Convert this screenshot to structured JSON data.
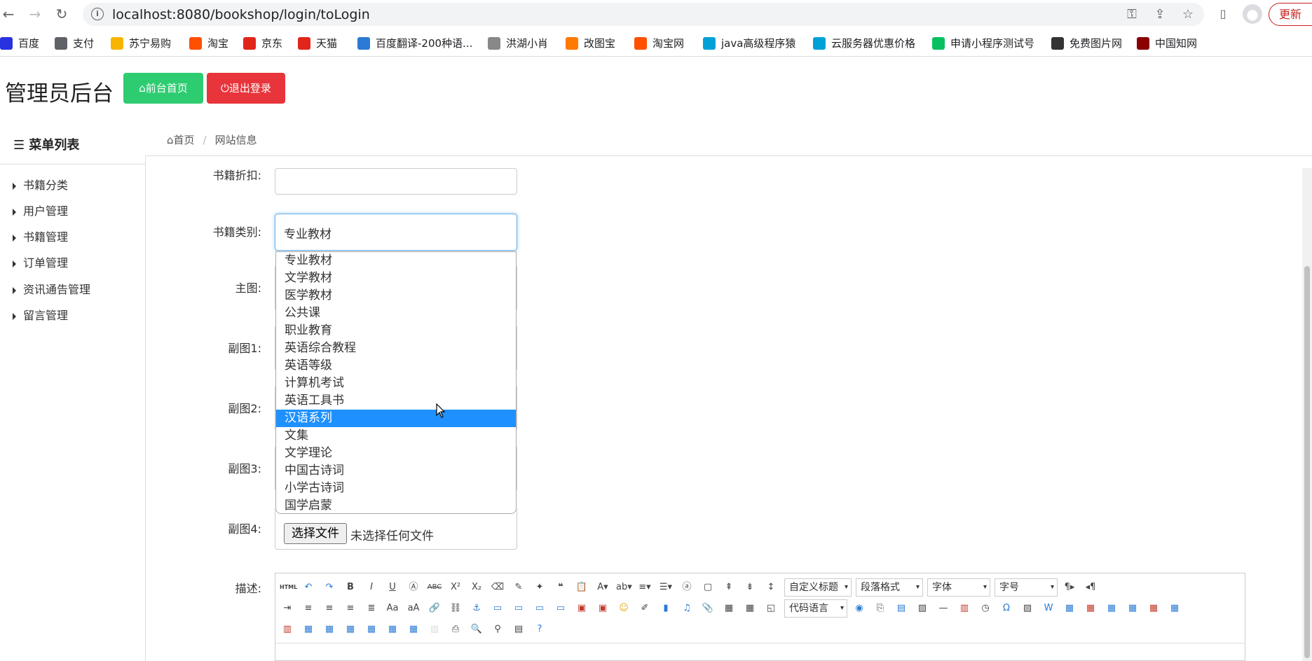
{
  "browser": {
    "url": "localhost:8080/bookshop/login/toLogin",
    "update_label": "更新",
    "bookmarks": [
      {
        "label": "百度",
        "color": "#2932e1",
        "icon": "paw-icon"
      },
      {
        "label": "支付",
        "color": "#5f6368",
        "icon": "globe-icon"
      },
      {
        "label": "苏宁易购",
        "color": "#f7b500",
        "icon": "lion-icon"
      },
      {
        "label": "淘宝",
        "color": "#ff5000",
        "icon": "tao-icon"
      },
      {
        "label": "京东",
        "color": "#e1251b",
        "icon": "jd-icon"
      },
      {
        "label": "天猫",
        "color": "#e1251b",
        "icon": "tmall-icon"
      },
      {
        "label": "百度翻译-200种语...",
        "color": "#2b7bd4",
        "icon": "translate-icon"
      },
      {
        "label": "洪湖小肖",
        "color": "#888888",
        "icon": "feather-icon"
      },
      {
        "label": "改图宝",
        "color": "#ff7a00",
        "icon": "image-icon"
      },
      {
        "label": "淘宝网",
        "color": "#ff5000",
        "icon": "tao-icon"
      },
      {
        "label": "java高级程序猿",
        "color": "#00a1d6",
        "icon": "bilibili-icon"
      },
      {
        "label": "云服务器优惠价格",
        "color": "#00a1d6",
        "icon": "cloud-icon"
      },
      {
        "label": "申请小程序测试号",
        "color": "#07c160",
        "icon": "wechat-icon"
      },
      {
        "label": "免费图片网",
        "color": "#333333",
        "icon": "t-icon"
      },
      {
        "label": "中国知网",
        "color": "#8b0000",
        "icon": "cnki-icon"
      }
    ]
  },
  "header": {
    "title": "管理员后台",
    "home_label": "前台首页",
    "logout_label": "退出登录"
  },
  "sidebar": {
    "title": "菜单列表",
    "items": [
      "书籍分类",
      "用户管理",
      "书籍管理",
      "订单管理",
      "资讯通告管理",
      "留言管理"
    ]
  },
  "breadcrumb": {
    "home": "首页",
    "current": "网站信息"
  },
  "form": {
    "discount_label": "书籍折扣:",
    "category_label": "书籍类别:",
    "category_value": "专业教材",
    "main_image_label": "主图:",
    "sub1_label": "副图1:",
    "sub2_label": "副图2:",
    "sub3_label": "副图3:",
    "sub4_label": "副图4:",
    "file_button": "选择文件",
    "file_status": "未选择任何文件",
    "desc_label": "描述:"
  },
  "dropdown": {
    "options": [
      "专业教材",
      "文学教材",
      "医学教材",
      "公共课",
      "职业教育",
      "英语综合教程",
      "英语等级",
      "计算机考试",
      "英语工具书",
      "汉语系列",
      "文集",
      "文学理论",
      "中国古诗词",
      "小学古诗词",
      "国学启蒙"
    ],
    "highlighted": "汉语系列"
  },
  "editor": {
    "selects": [
      "自定义标题",
      "段落格式",
      "字体",
      "字号"
    ],
    "code_lang": "代码语言"
  }
}
